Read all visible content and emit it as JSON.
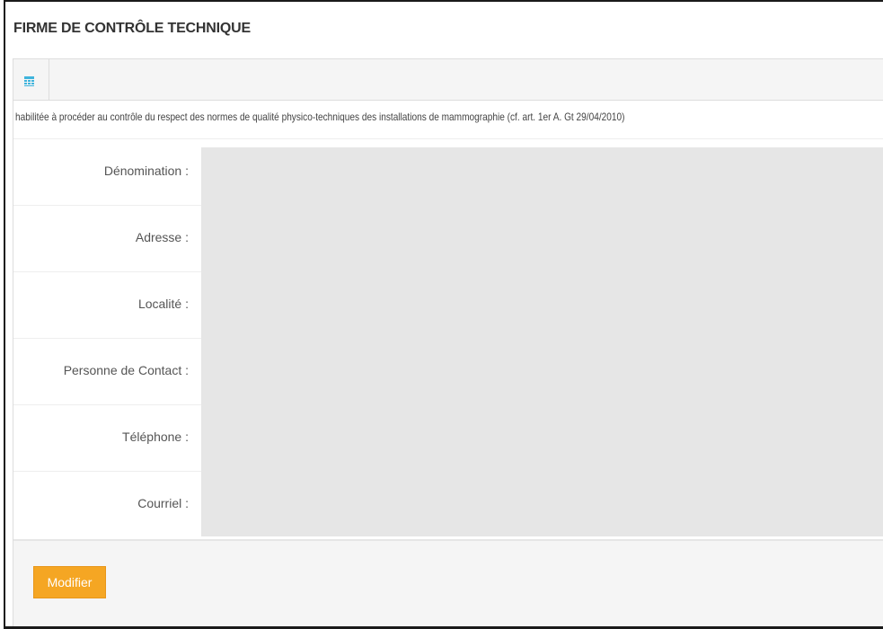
{
  "header": {
    "title": "FIRME DE CONTRÔLE TECHNIQUE"
  },
  "toolbar": {
    "icon": "calendar-icon",
    "icon_color": "#3fb4dc"
  },
  "panel": {
    "description": "habilitée à procéder au contrôle du respect des normes de qualité physico-techniques des installations de mammographie (cf. art. 1er A. Gt 29/04/2010)"
  },
  "form": {
    "fields": [
      {
        "label": "Dénomination :",
        "value": ""
      },
      {
        "label": "Adresse :",
        "value": ""
      },
      {
        "label": "Localité :",
        "value": ""
      },
      {
        "label": "Personne de Contact :",
        "value": ""
      },
      {
        "label": "Téléphone :",
        "value": ""
      },
      {
        "label": "Courriel :",
        "value": ""
      }
    ]
  },
  "footer": {
    "modify_label": "Modifier",
    "modify_color": "#f5a623"
  }
}
